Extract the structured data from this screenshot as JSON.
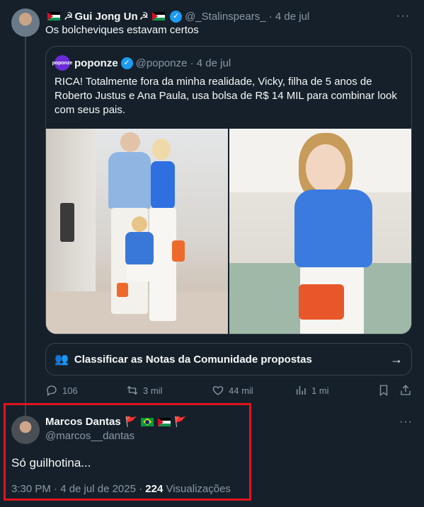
{
  "tweet1": {
    "name": "Gui Jong Un",
    "handle": "@_Stalinspears_",
    "date": "4 de jul",
    "text": "Os bolcheviques estavam certos",
    "more": "···"
  },
  "quote": {
    "avatar_text": "poponze",
    "name": "poponze",
    "handle": "@poponze",
    "date": "4 de jul",
    "text": "RICA! Totalmente fora da minha realidade, Vicky, filha de 5 anos de Roberto Justus e Ana Paula, usa bolsa de R$ 14 MIL para combinar look com seus pais."
  },
  "notes": {
    "label": "Classificar as Notas da Comunidade propostas",
    "arrow": "→"
  },
  "actions": {
    "replies": "106",
    "retweets": "3 mil",
    "likes": "44 mil",
    "views": "1 mi"
  },
  "tweet2": {
    "name": "Marcos Dantas",
    "handle": "@marcos__dantas",
    "text": "Só guilhotina...",
    "time_date": "3:30 PM · 4 de jul de 2025 · ",
    "views_count": "224",
    "views_label": " Visualizações",
    "more": "···"
  },
  "icons": {
    "hammer_sickle": "☭",
    "verified": "✓",
    "red_flag": "🚩",
    "people": "👥"
  },
  "colors": {
    "background": "#15202b",
    "accent": "#1d9bf0",
    "highlight": "#e0141d"
  }
}
